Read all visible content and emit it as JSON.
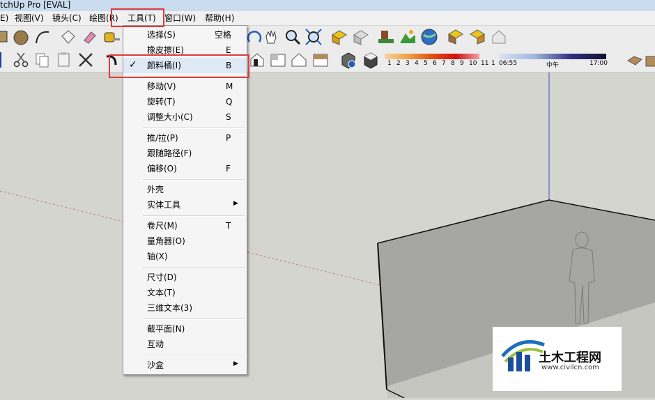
{
  "window": {
    "title": "tchUp Pro [EVAL]"
  },
  "menubar": {
    "items": [
      {
        "label": "E)"
      },
      {
        "label": "视图(V)"
      },
      {
        "label": "镜头(C)"
      },
      {
        "label": "绘图(R)"
      },
      {
        "label": "工具(T)"
      },
      {
        "label": "窗口(W)"
      },
      {
        "label": "帮助(H)"
      }
    ]
  },
  "tools_menu": {
    "items": [
      {
        "label": "选择(S)",
        "shortcut": "空格"
      },
      {
        "label": "橡皮擦(E)",
        "shortcut": "E"
      },
      {
        "label": "颜料桶(I)",
        "shortcut": "B",
        "checked": true
      },
      {
        "label": "移动(V)",
        "shortcut": "M"
      },
      {
        "label": "旋转(T)",
        "shortcut": "Q"
      },
      {
        "label": "调整大小(C)",
        "shortcut": "S"
      },
      {
        "label": "推/拉(P)",
        "shortcut": "P"
      },
      {
        "label": "跟随路径(F)",
        "shortcut": ""
      },
      {
        "label": "偏移(O)",
        "shortcut": "F"
      },
      {
        "label": "外壳",
        "shortcut": ""
      },
      {
        "label": "实体工具",
        "shortcut": "",
        "submenu": true
      },
      {
        "label": "卷尺(M)",
        "shortcut": "T"
      },
      {
        "label": "量角器(O)",
        "shortcut": ""
      },
      {
        "label": "轴(X)",
        "shortcut": ""
      },
      {
        "label": "尺寸(D)",
        "shortcut": ""
      },
      {
        "label": "文本(T)",
        "shortcut": ""
      },
      {
        "label": "三维文本(3)",
        "shortcut": ""
      },
      {
        "label": "截平面(N)",
        "shortcut": ""
      },
      {
        "label": "互动",
        "shortcut": ""
      },
      {
        "label": "沙盒",
        "shortcut": "",
        "submenu": true
      }
    ]
  },
  "shadow_settings": {
    "months": [
      "1",
      "2",
      "3",
      "4",
      "5",
      "6",
      "7",
      "8",
      "9",
      "10",
      "11",
      "1"
    ],
    "time_start": "06:55",
    "time_mid": "中午",
    "time_end": "17:00"
  },
  "watermark": {
    "name": "土木工程网",
    "url": "www.civilcn.com"
  },
  "colors": {
    "highlight": "#e23a3a",
    "viewport_bg": "#d4d5ce",
    "sky_axis": "#4a4ad0"
  }
}
